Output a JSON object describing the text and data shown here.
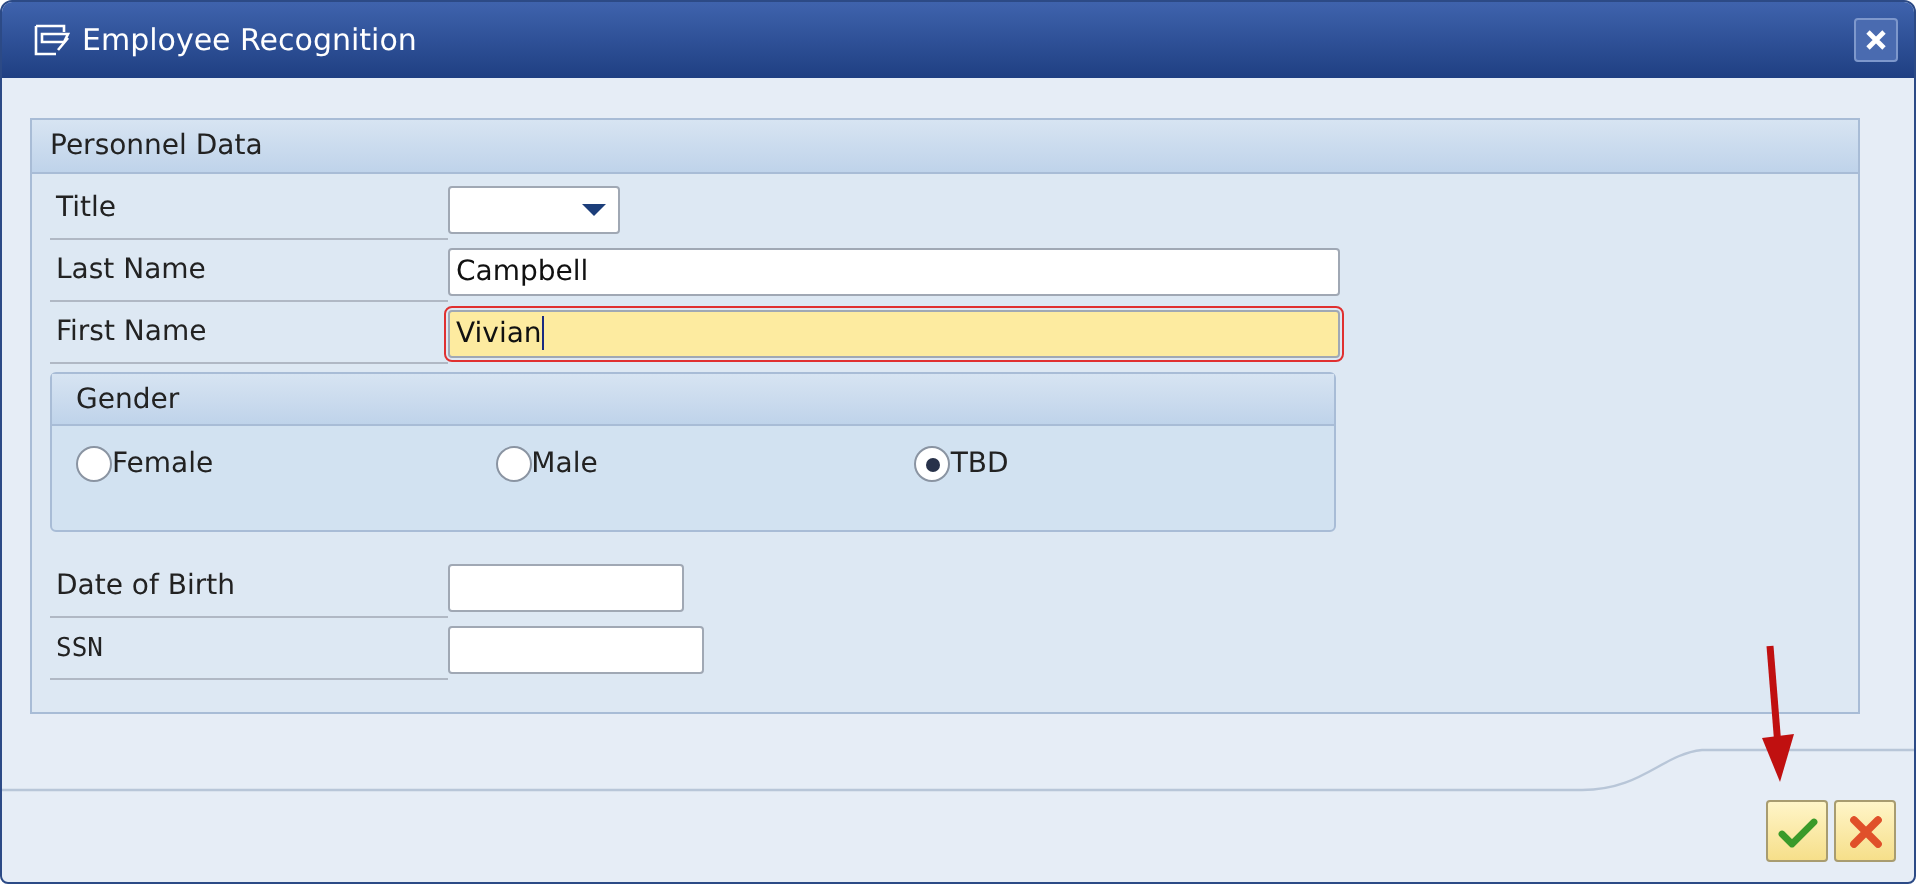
{
  "window": {
    "title": "Employee Recognition"
  },
  "group": {
    "title": "Personnel Data"
  },
  "fields": [
    {
      "kind": "dropdown",
      "label": "Title"
    },
    {
      "kind": "text",
      "label": "Last Name",
      "value": "Campbell",
      "focused": false
    },
    {
      "kind": "text",
      "label": "First Name",
      "value": "Vivian",
      "focused": true
    }
  ],
  "gender": {
    "title": "Gender",
    "options": [
      {
        "label": "Female",
        "selected": false
      },
      {
        "label": "Male",
        "selected": false
      },
      {
        "label": "TBD",
        "selected": true
      }
    ]
  },
  "fields_lower": [
    {
      "kind": "date",
      "label": "Date of Birth"
    },
    {
      "kind": "mono",
      "label": "SSN"
    }
  ],
  "buttons": [
    {
      "kind": "confirm"
    },
    {
      "kind": "cancel"
    }
  ]
}
